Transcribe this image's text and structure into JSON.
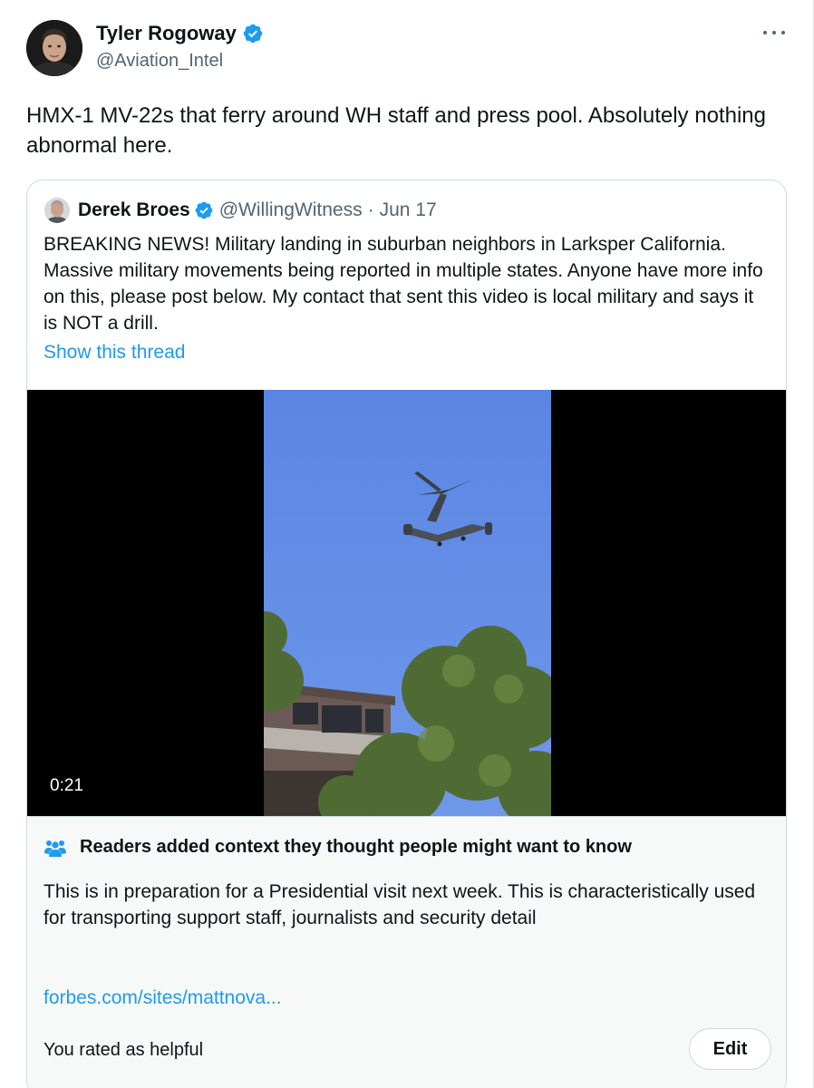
{
  "tweet": {
    "author": {
      "name": "Tyler Rogoway",
      "handle": "@Aviation_Intel",
      "verified": true
    },
    "text": "HMX-1 MV-22s that ferry around WH staff and press pool. Absolutely nothing abnormal here."
  },
  "quoted_tweet": {
    "author": {
      "name": "Derek Broes",
      "handle": "@WillingWitness",
      "verified": true
    },
    "separator": "·",
    "date": "Jun 17",
    "text": "BREAKING NEWS!  Military landing in suburban neighbors in Larksper California. Massive military movements being reported in multiple states. Anyone have more info on this, please post below. My contact that sent this video is local military and says it is NOT a drill.",
    "show_thread": "Show this thread",
    "video": {
      "duration": "0:21"
    }
  },
  "community_note": {
    "title": "Readers added context they thought people might want to know",
    "body": "This is in preparation for a Presidential visit next week.  This is characteristically used for transporting support staff, journalists and security detail",
    "link": "forbes.com/sites/mattnova...",
    "rating_status": "You rated as helpful",
    "edit_label": "Edit"
  },
  "colors": {
    "verified": "#1d9bf0",
    "link": "#1d9bf0",
    "muted_text": "#536471",
    "note_background": "#f7f9f9",
    "border": "#cfd9de"
  },
  "icons": {
    "verified": "verified-badge-icon",
    "more": "more-horizontal-icon",
    "community_notes": "people-icon"
  }
}
